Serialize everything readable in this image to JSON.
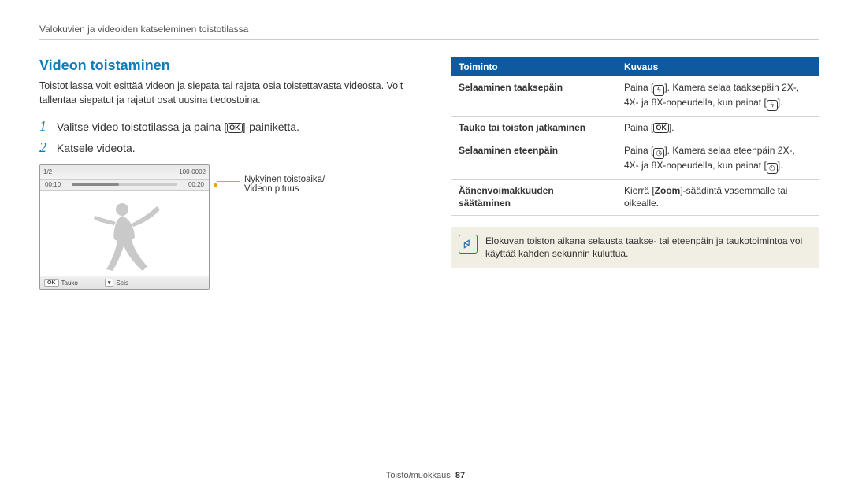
{
  "breadcrumb": "Valokuvien ja videoiden katseleminen toistotilassa",
  "section_title": "Videon toistaminen",
  "intro": "Toistotilassa voit esittää videon ja siepata tai rajata osia toistettavasta videosta. Voit tallentaa siepatut ja rajatut osat uusina tiedostoina.",
  "steps": {
    "s1_pre": "Valitse video toistotilassa ja paina [",
    "s1_post": "]-painiketta.",
    "s2": "Katsele videota."
  },
  "nums": {
    "n1": "1",
    "n2": "2"
  },
  "screen": {
    "top_left": "1/2",
    "top_right": "100-0002",
    "time_cur": "00:10",
    "time_total": "00:20",
    "btn_ok": "OK",
    "btn_pause": "Tauko",
    "btn_stop": "Seis"
  },
  "callout": {
    "line1": "Nykyinen toistoaika/",
    "line2": "Videon pituus"
  },
  "table": {
    "h1": "Toiminto",
    "h2": "Kuvaus",
    "r1f": "Selaaminen taaksepäin",
    "r1d_a": "Paina [",
    "r1d_b": "]. Kamera selaa taaksepäin 2X-, 4X- ja 8X-nopeudella, kun painat [",
    "r1d_c": "].",
    "r2f": "Tauko tai toiston jatkaminen",
    "r2d_a": "Paina [",
    "r2d_b": "].",
    "r3f": "Selaaminen eteenpäin",
    "r3d_a": "Paina [",
    "r3d_b": "]. Kamera selaa eteenpäin 2X-, 4X- ja 8X-nopeudella, kun painat [",
    "r3d_c": "].",
    "r4f": "Äänenvoimakkuuden säätäminen",
    "r4d_a": "Kierrä [",
    "r4d_zoom": "Zoom",
    "r4d_b": "]-säädintä vasemmalle tai oikealle."
  },
  "note": "Elokuvan toiston aikana selausta taakse- tai eteenpäin ja taukotoimintoa voi käyttää kahden sekunnin kuluttua.",
  "footer": {
    "label": "Toisto/muokkaus",
    "page": "87"
  },
  "icons": {
    "ok": "OK",
    "flash": "⚡",
    "timer": "◔"
  }
}
